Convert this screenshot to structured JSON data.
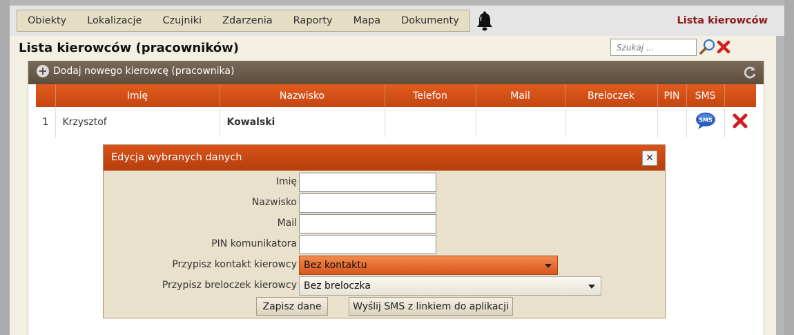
{
  "menu": [
    "Obiekty",
    "Lokalizacje",
    "Czujniki",
    "Zdarzenia",
    "Raporty",
    "Mapa",
    "Dokumenty"
  ],
  "icons": {
    "bell": "bell-icon",
    "search": "search-icon",
    "clear": "clear-icon",
    "add": "plus-icon",
    "refresh": "refresh-icon",
    "sms": "sms-icon",
    "delete": "delete-icon",
    "close": "close-icon"
  },
  "page_link": "Lista kierowców",
  "page_title": "Lista kierowców (pracowników)",
  "search": {
    "placeholder": "Szukaj ..."
  },
  "panel": {
    "add_label": "Dodaj nowego kierowcę (pracownika)"
  },
  "table": {
    "headers": [
      "",
      "Imię",
      "Nazwisko",
      "Telefon",
      "Mail",
      "Breloczek",
      "PIN",
      "SMS",
      ""
    ],
    "rows": [
      {
        "num": "1",
        "first": "Krzysztof",
        "last": "Kowalski",
        "phone": "",
        "mail": "",
        "fob": "",
        "pin": ""
      }
    ]
  },
  "dialog": {
    "title": "Edycja wybranych danych",
    "labels": {
      "first": "Imię",
      "last": "Nazwisko",
      "mail": "Mail",
      "pin": "PIN komunikatora",
      "contact": "Przypisz kontakt kierowcy",
      "fob": "Przypisz breloczek kierowcy"
    },
    "values": {
      "first": "",
      "last": "",
      "mail": "",
      "pin": ""
    },
    "contact_selected": "Bez kontaktu",
    "fob_selected": "Bez breloczka",
    "save_label": "Zapisz dane",
    "sms_label": "Wyślij SMS z linkiem do aplikacji"
  },
  "colors": {
    "accent": "#d8531a",
    "page_link": "#8b1a1a",
    "panel_header": "#6b5b4a",
    "sms_blue": "#2a5fc2",
    "delete_red": "#d01f1f"
  }
}
